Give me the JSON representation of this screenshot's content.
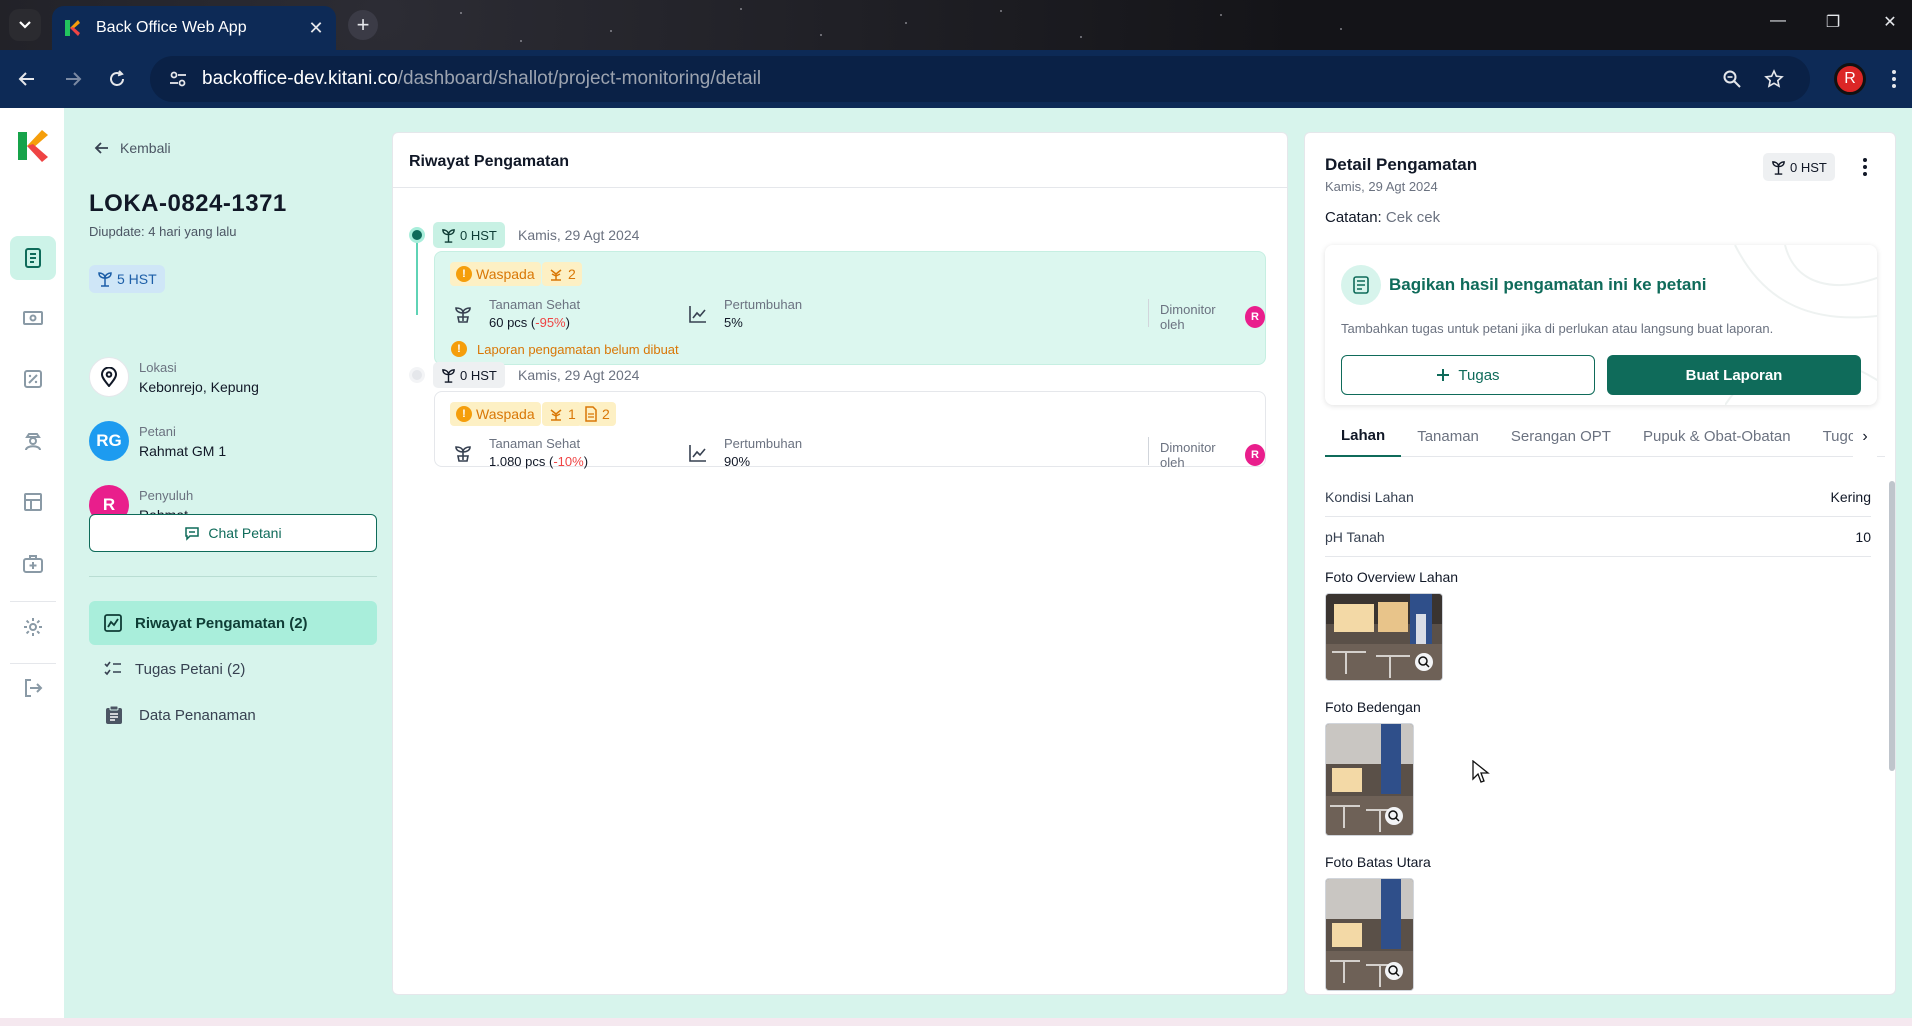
{
  "browser": {
    "tab_title": "Back Office Web App",
    "url_host": "backoffice-dev.kitani.co",
    "url_path": "/dashboard/shallot/project-monitoring/detail",
    "profile_initial": "R"
  },
  "left_panel": {
    "back_label": "Kembali",
    "project_code": "LOKA-0824-1371",
    "updated": "Diupdate: 4 hari yang lalu",
    "hst": "5 HST",
    "location_label": "Lokasi",
    "location_value": "Kebonrejo, Kepung",
    "farmer_label": "Petani",
    "farmer_value": "Rahmat GM 1",
    "farmer_initials": "RG",
    "extension_label": "Penyuluh",
    "extension_value": "Rahmat",
    "extension_initial": "R",
    "chat_button": "Chat Petani",
    "menu": [
      {
        "label": "Riwayat Pengamatan (2)"
      },
      {
        "label": "Tugas Petani (2)"
      },
      {
        "label": "Data Penanaman"
      }
    ]
  },
  "history": {
    "title": "Riwayat Pengamatan",
    "entries": [
      {
        "hst": "0 HST",
        "date": "Kamis, 29 Agt 2024",
        "status": "Waspada",
        "pest_count": "2",
        "healthy_label": "Tanaman Sehat",
        "healthy_value": "60 pcs",
        "healthy_delta": "-95%",
        "growth_label": "Pertumbuhan",
        "growth_value": "5%",
        "monitored_by": "Dimonitor oleh",
        "monitor_initial": "R",
        "note": "Laporan pengamatan belum dibuat"
      },
      {
        "hst": "0 HST",
        "date": "Kamis, 29 Agt 2024",
        "status": "Waspada",
        "pest_count": "1",
        "doc_count": "2",
        "healthy_label": "Tanaman Sehat",
        "healthy_value": "1.080 pcs",
        "healthy_delta": "-10%",
        "growth_label": "Pertumbuhan",
        "growth_value": "90%",
        "monitored_by": "Dimonitor oleh",
        "monitor_initial": "R"
      }
    ]
  },
  "detail": {
    "title": "Detail Pengamatan",
    "date": "Kamis, 29 Agt 2024",
    "hst": "0 HST",
    "note_label": "Catatan:",
    "note_value": "Cek cek",
    "share_title": "Bagikan hasil pengamatan ini ke petani",
    "share_desc": "Tambahkan tugas untuk petani jika di perlukan atau langsung buat laporan.",
    "btn_task": "Tugas",
    "btn_report": "Buat Laporan",
    "tabs": [
      "Lahan",
      "Tanaman",
      "Serangan OPT",
      "Pupuk & Obat-Obatan",
      "Tugc"
    ],
    "fields": [
      {
        "label": "Kondisi Lahan",
        "value": "Kering"
      },
      {
        "label": "pH Tanah",
        "value": "10"
      }
    ],
    "photos": [
      {
        "label": "Foto Overview Lahan"
      },
      {
        "label": "Foto Bedengan"
      },
      {
        "label": "Foto Batas Utara"
      }
    ]
  },
  "colors": {
    "primary": "#0f6b5a",
    "mint_bg": "#d7f4ec",
    "warning": "#d97706",
    "negative": "#ef4444",
    "browser_chrome": "#0d2a56"
  }
}
